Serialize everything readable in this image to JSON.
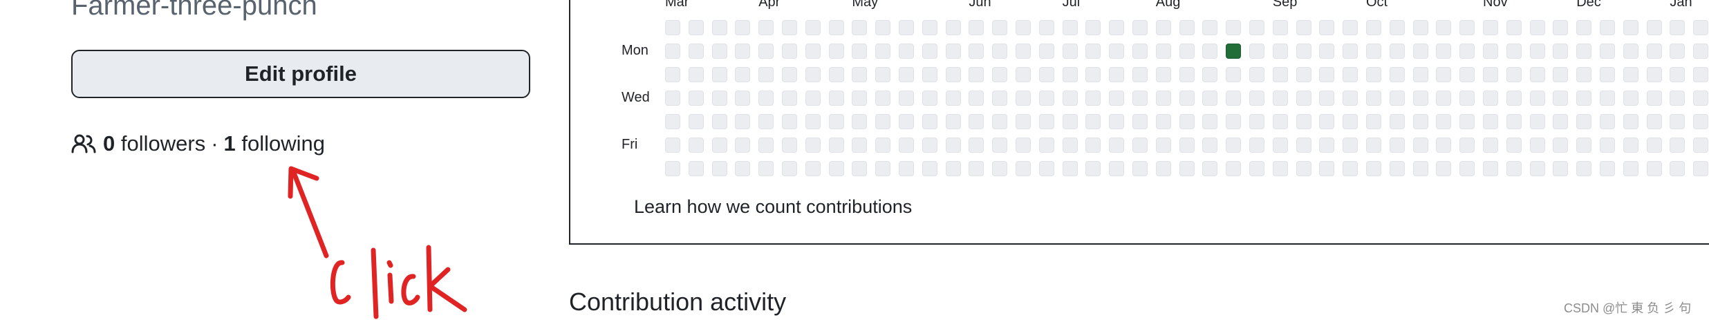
{
  "profile": {
    "username": "Farmer-three-punch",
    "edit_button_label": "Edit profile",
    "followers_count": "0",
    "followers_label": "followers",
    "separator": "·",
    "following_count": "1",
    "following_label": "following"
  },
  "annotation": {
    "text": "Click",
    "color": "#e02424"
  },
  "contributions": {
    "months": [
      "Mar",
      "Apr",
      "May",
      "Jun",
      "Jul",
      "Aug",
      "Sep",
      "Oct",
      "Nov",
      "Dec",
      "Jan"
    ],
    "day_labels": [
      "Mon",
      "Wed",
      "Fri"
    ],
    "active_cells": [
      {
        "week": 24,
        "day": 1,
        "level": 3
      }
    ],
    "empty_color": "#ebedf0",
    "active_color": "#216e39",
    "learn_link": "Learn how we count contributions"
  },
  "activity": {
    "title": "Contribution activity"
  },
  "watermark": "CSDN @忙 東 负 彡 句"
}
